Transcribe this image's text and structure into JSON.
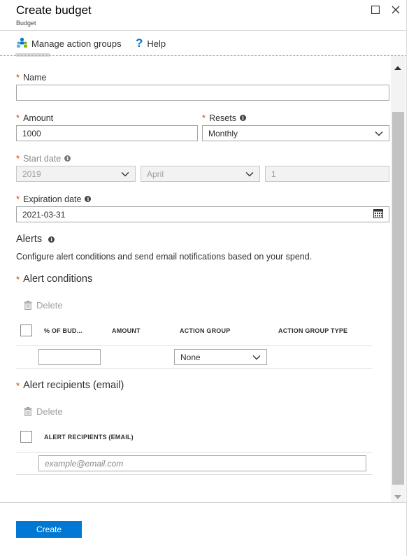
{
  "header": {
    "title": "Create budget",
    "subtitle": "Budget"
  },
  "toolbar": {
    "manage_action_groups": "Manage action groups",
    "help": "Help"
  },
  "form": {
    "name_label": "Name",
    "name_value": "",
    "amount_label": "Amount",
    "amount_value": "1000",
    "resets_label": "Resets",
    "resets_value": "Monthly",
    "start_date_label": "Start date",
    "start_year": "2019",
    "start_month": "April",
    "start_day": "1",
    "expiration_label": "Expiration date",
    "expiration_value": "2021-03-31"
  },
  "alerts": {
    "title": "Alerts",
    "description": "Configure alert conditions and send email notifications based on your spend.",
    "conditions_title": "Alert conditions",
    "delete_label": "Delete",
    "columns": [
      "% OF BUD...",
      "AMOUNT",
      "ACTION GROUP",
      "ACTION GROUP TYPE"
    ],
    "row_action_group": "None",
    "recipients_title": "Alert recipients (email)",
    "recipients_delete_label": "Delete",
    "recipients_column": "ALERT RECIPIENTS (EMAIL)",
    "email_placeholder": "example@email.com"
  },
  "footer": {
    "create_label": "Create"
  },
  "colors": {
    "accent": "#0078d4",
    "required": "#d83b01"
  }
}
